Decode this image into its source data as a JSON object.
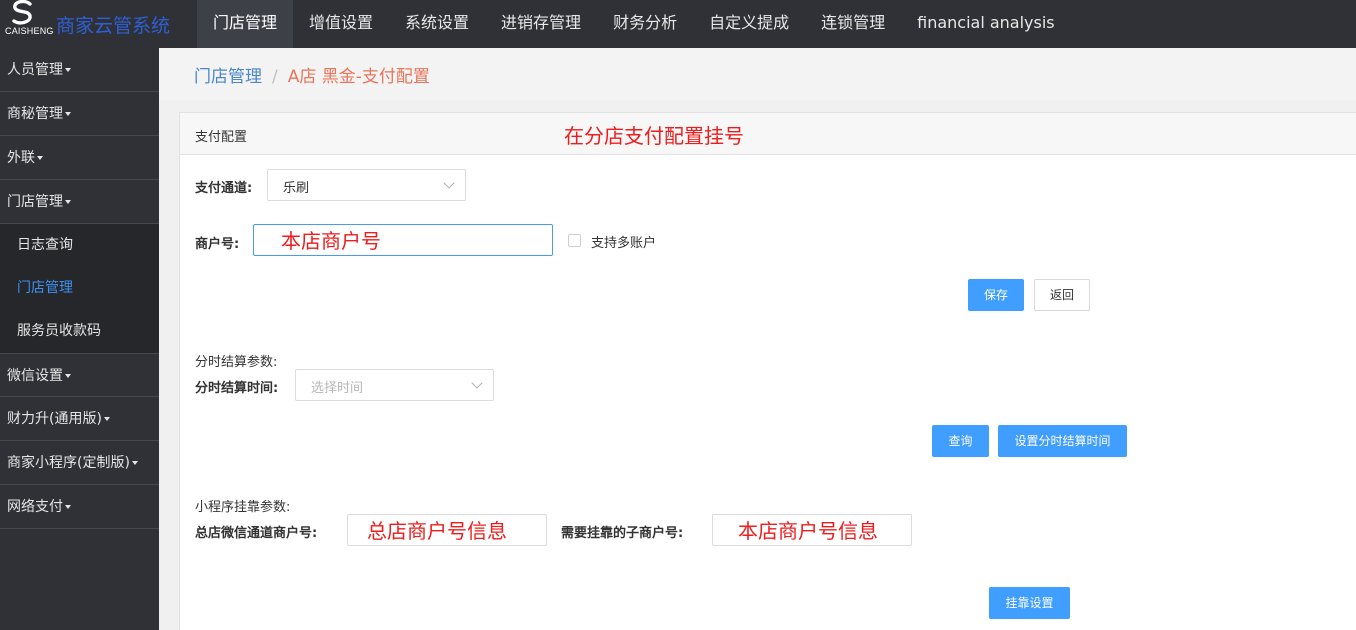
{
  "brand": {
    "sub": "CAISHENG",
    "title": "商家云管系统"
  },
  "nav": [
    "门店管理",
    "增值设置",
    "系统设置",
    "进销存管理",
    "财务分析",
    "自定义提成",
    "连锁管理",
    "financial analysis"
  ],
  "sidebar": {
    "items": [
      "人员管理",
      "商秘管理",
      "外联",
      "门店管理"
    ],
    "sub": [
      "日志查询",
      "门店管理",
      "服务员收款码"
    ],
    "items2": [
      "微信设置",
      "财力升(通用版)",
      "商家小程序(定制版)",
      "网络支付"
    ]
  },
  "breadcrumb": {
    "root": "门店管理",
    "sep": "/",
    "current": "A店 黑金-支付配置"
  },
  "panel": {
    "title": "支付配置",
    "annotation": "在分店支付配置挂号"
  },
  "form": {
    "channel_label": "支付通道:",
    "channel_value": "乐刷",
    "merchant_label": "商户号:",
    "merchant_value": "本店商户号",
    "multi_account_label": "支持多账户",
    "save": "保存",
    "back": "返回",
    "timed_title": "分时结算参数:",
    "timed_label": "分时结算时间:",
    "timed_placeholder": "选择时间",
    "query": "查询",
    "set_timed": "设置分时结算时间",
    "mini_title": "小程序挂靠参数:",
    "hq_label": "总店微信通道商户号:",
    "hq_value": "总店商户号信息",
    "sub_label": "需要挂靠的子商户号:",
    "sub_value": "本店商户号信息",
    "attach": "挂靠设置"
  }
}
